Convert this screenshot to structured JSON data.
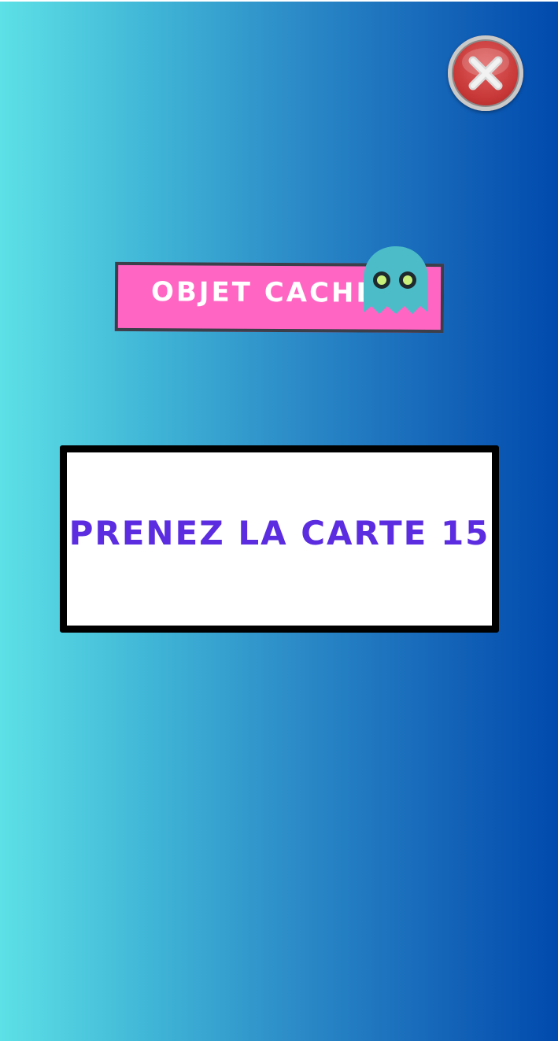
{
  "colors": {
    "gradient_left": "#5de0e6",
    "gradient_right": "#004aad",
    "banner_bg": "#ff66c4",
    "card_text": "#5b2ce0",
    "ghost": "#4bbcc8",
    "close_button": "#c83838"
  },
  "header": {
    "close_icon": "close-x-icon"
  },
  "banner": {
    "title": "OBJET CACHÉ",
    "icon": "ghost-icon"
  },
  "card": {
    "message": "PRENEZ LA CARTE 15"
  }
}
